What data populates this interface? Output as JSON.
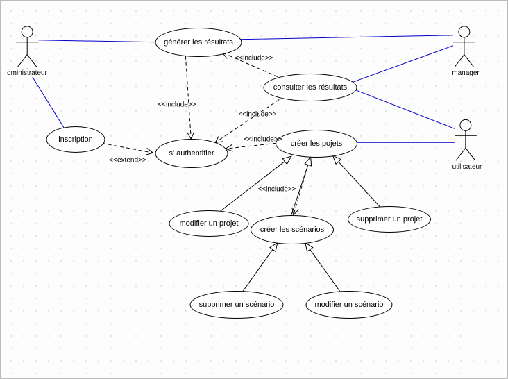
{
  "diagram": {
    "type": "uml-use-case",
    "actors": {
      "admin": "dministrateur",
      "manager": "manager",
      "user": "utilisateur"
    },
    "usecases": {
      "generer": "générer les résultats",
      "consulter": "consulter les résultats",
      "inscription": "inscription",
      "auth": "s' authentifier",
      "creer_projets": "créer les pojets",
      "modifier_projet": "modifier un projet",
      "creer_scenarios": "créer les scénarios",
      "supprimer_projet": "supprimer un projet",
      "supprimer_scenario": "supprimer un scénario",
      "modifier_scenario": "modifier un scénario"
    },
    "stereotypes": {
      "include": "<<include>>",
      "extend": "<<extend>>"
    }
  },
  "chart_data": {
    "type": "diagram",
    "diagram_kind": "uml-use-case",
    "actors": [
      "dministrateur",
      "manager",
      "utilisateur"
    ],
    "usecases": [
      "générer les résultats",
      "consulter les résultats",
      "inscription",
      "s' authentifier",
      "créer les pojets",
      "modifier un projet",
      "créer les scénarios",
      "supprimer un projet",
      "supprimer un scénario",
      "modifier un scénario"
    ],
    "associations": [
      {
        "from": "dministrateur",
        "to": "générer les résultats"
      },
      {
        "from": "dministrateur",
        "to": "inscription"
      },
      {
        "from": "manager",
        "to": "générer les résultats"
      },
      {
        "from": "manager",
        "to": "consulter les résultats"
      },
      {
        "from": "utilisateur",
        "to": "consulter les résultats"
      },
      {
        "from": "utilisateur",
        "to": "créer les pojets"
      }
    ],
    "dependencies": [
      {
        "from": "générer les résultats",
        "to": "s' authentifier",
        "stereotype": "include"
      },
      {
        "from": "consulter les résultats",
        "to": "générer les résultats",
        "stereotype": "include"
      },
      {
        "from": "consulter les résultats",
        "to": "s' authentifier",
        "stereotype": "include"
      },
      {
        "from": "créer les pojets",
        "to": "s' authentifier",
        "stereotype": "include"
      },
      {
        "from": "créer les pojets",
        "to": "créer les scénarios",
        "stereotype": "include"
      },
      {
        "from": "inscription",
        "to": "s' authentifier",
        "stereotype": "extend"
      }
    ],
    "generalizations": [
      {
        "child": "modifier un projet",
        "parent": "créer les pojets"
      },
      {
        "child": "créer les scénarios",
        "parent": "créer les pojets"
      },
      {
        "child": "supprimer un projet",
        "parent": "créer les pojets"
      },
      {
        "child": "supprimer un scénario",
        "parent": "créer les scénarios"
      },
      {
        "child": "modifier un scénario",
        "parent": "créer les scénarios"
      }
    ]
  }
}
